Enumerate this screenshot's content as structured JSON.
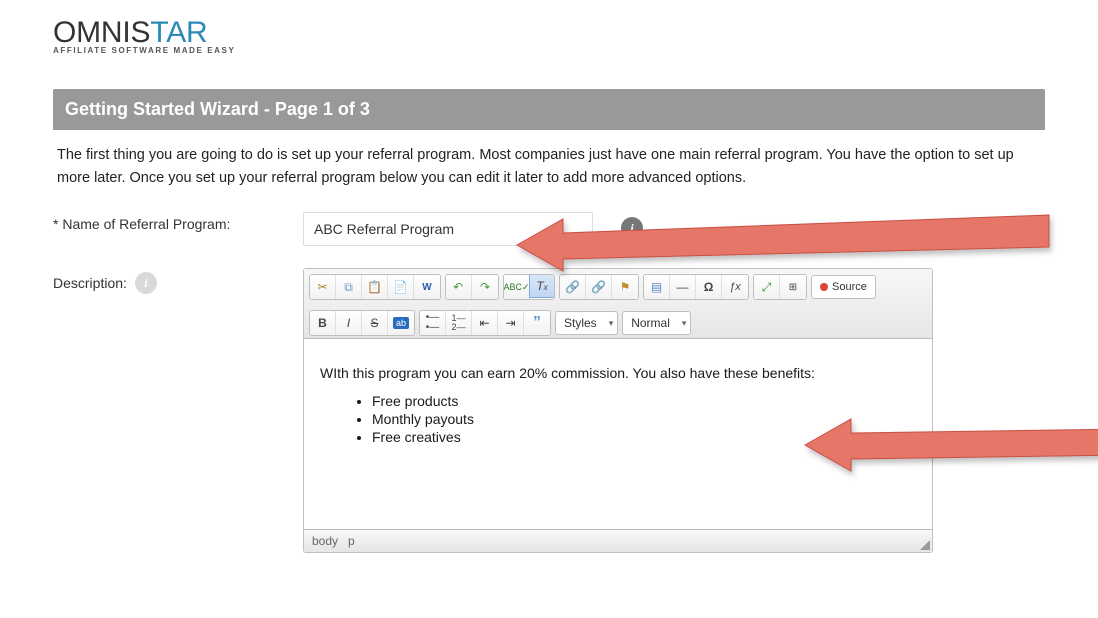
{
  "logo": {
    "word1": "OMNI",
    "word2_s": "S",
    "word2_tar": "TAR",
    "tagline": "AFFILIATE SOFTWARE MADE EASY"
  },
  "header": "Getting Started Wizard - Page 1 of 3",
  "intro": "The first thing you are going to do is set up your referral program. Most companies just have one main referral program. You have the option to set up more later. Once you set up your referral program below you can edit it later to add more advanced options.",
  "form": {
    "name_label": "* Name of Referral Program:",
    "name_value": "ABC Referral Program",
    "desc_label": "Description:"
  },
  "editor": {
    "combo_styles": "Styles",
    "combo_format": "Normal",
    "source_label": "Source",
    "content_para": "WIth this program you can earn 20% commission. You also have these benefits:",
    "bullets": [
      "Free products",
      "Monthly payouts",
      "Free creatives"
    ],
    "path_body": "body",
    "path_p": "p"
  }
}
